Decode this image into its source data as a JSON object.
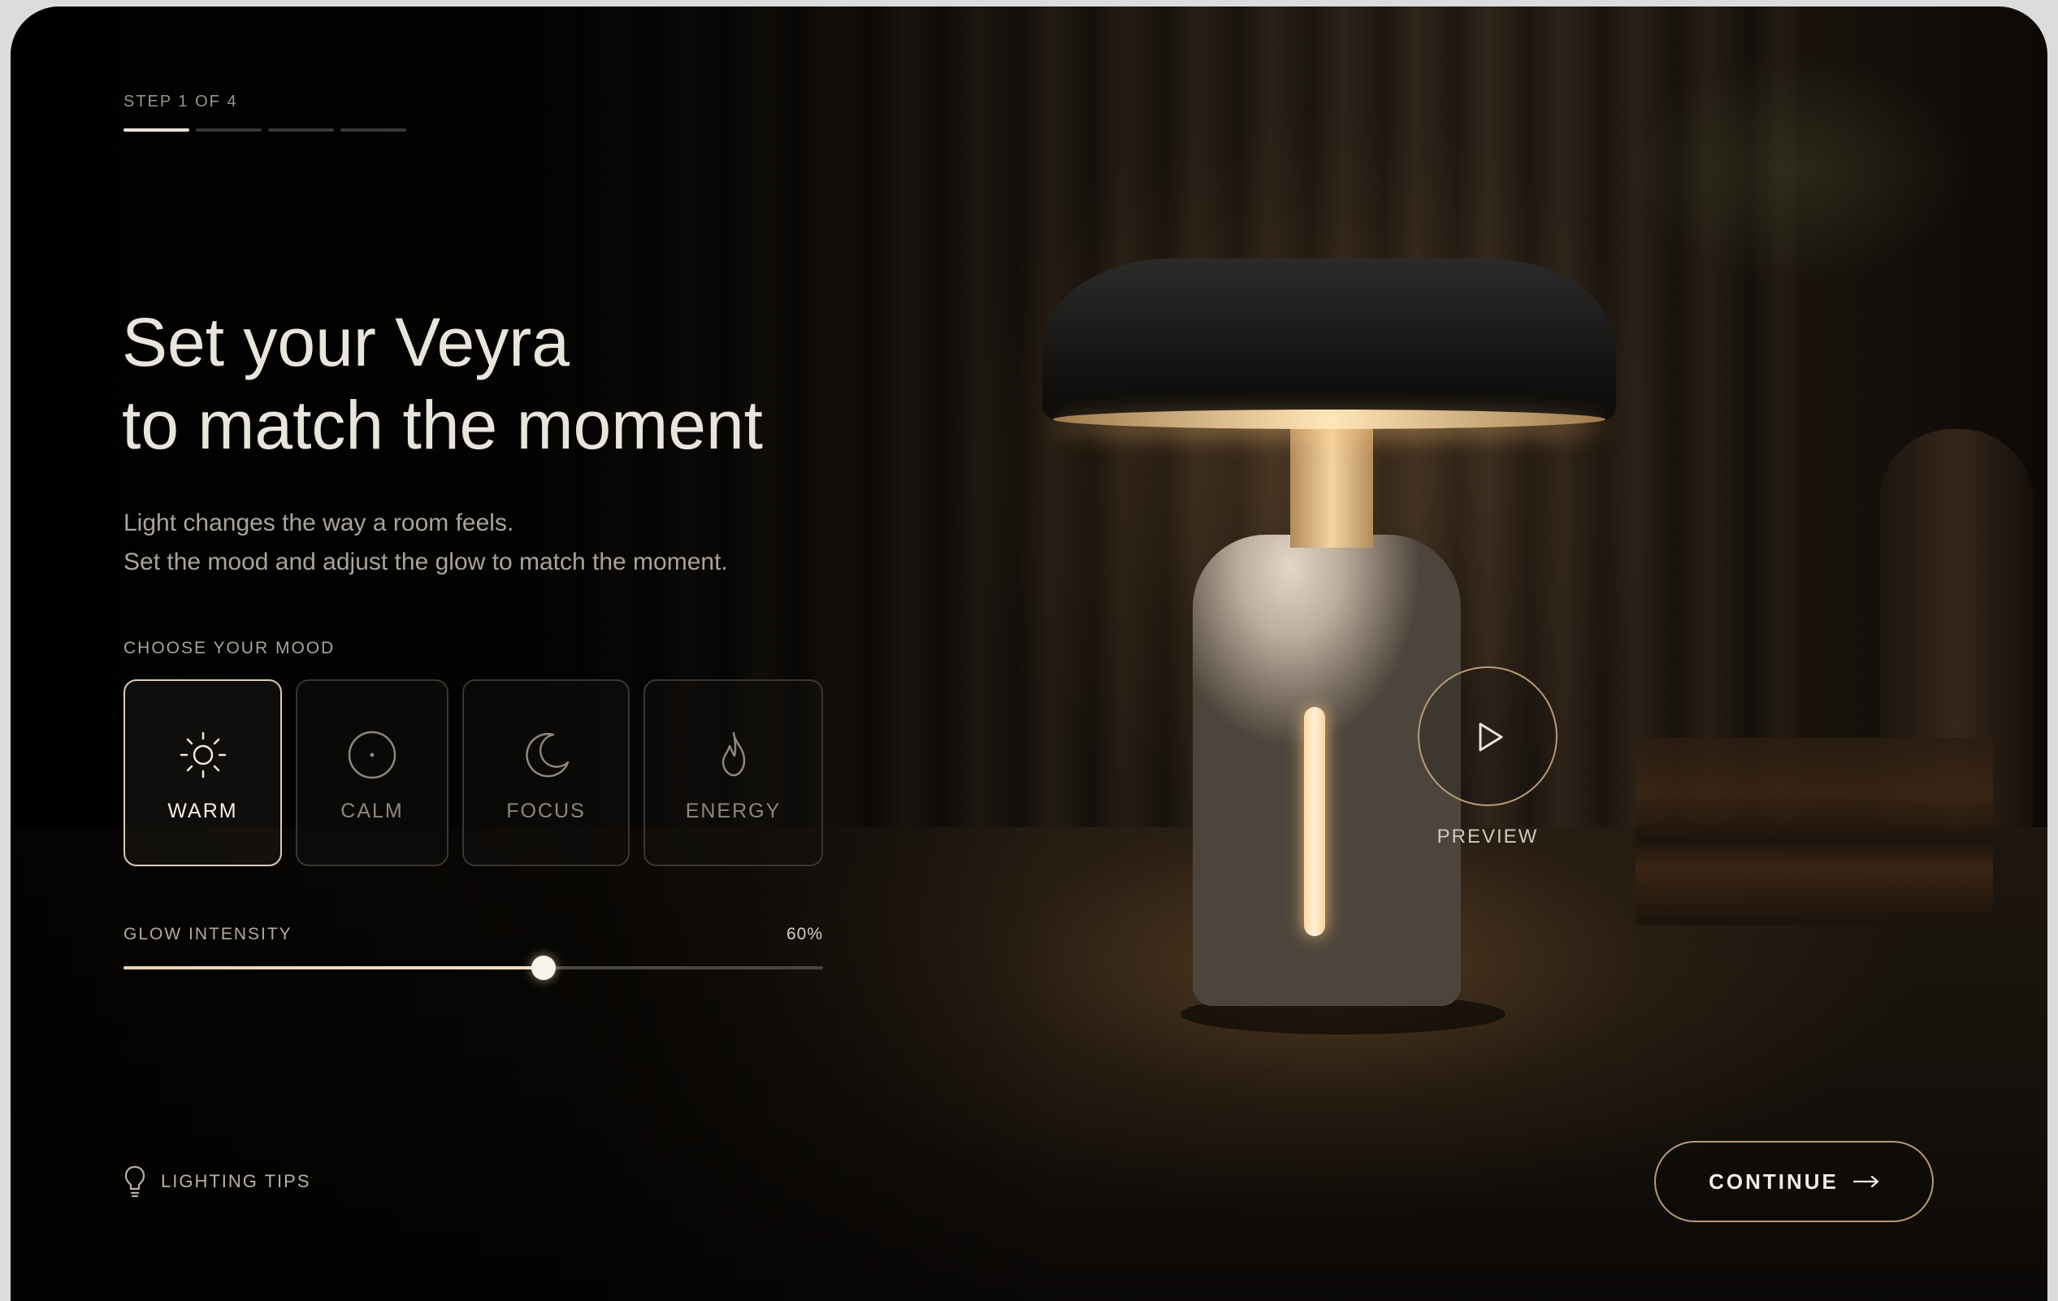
{
  "progress": {
    "label": "STEP 1 OF 4",
    "current_step": 1,
    "total_steps": 4
  },
  "hero": {
    "title_line1": "Set your Veyra",
    "title_line2": "to match the moment",
    "subtitle_line1": "Light changes the way a room feels.",
    "subtitle_line2": "Set the mood and adjust the glow to match the moment."
  },
  "mood": {
    "label": "CHOOSE YOUR MOOD",
    "selected": "WARM",
    "options": [
      {
        "name": "WARM",
        "icon": "sun-icon"
      },
      {
        "name": "CALM",
        "icon": "circle-dot-icon"
      },
      {
        "name": "FOCUS",
        "icon": "moon-icon"
      },
      {
        "name": "ENERGY",
        "icon": "flame-icon"
      }
    ]
  },
  "glow": {
    "label": "GLOW INTENSITY",
    "value_text": "60%",
    "value": 0.6
  },
  "preview": {
    "label": "PREVIEW",
    "icon": "play-icon"
  },
  "tips": {
    "label": "LIGHTING TIPS",
    "icon": "lightbulb-icon"
  },
  "cta": {
    "label": "CONTINUE",
    "icon": "arrow-right-icon"
  },
  "colors": {
    "accent": "#b89a78",
    "text": "#e9e4dc",
    "background": "#0d0b09"
  }
}
